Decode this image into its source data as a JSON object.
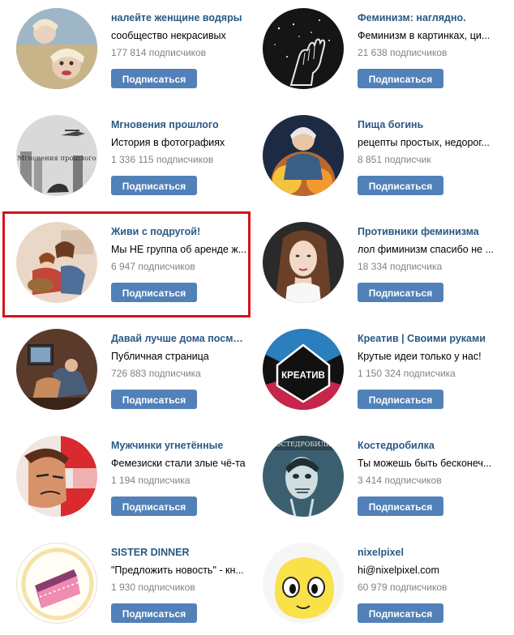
{
  "button_label": "Подписаться",
  "highlight_color": "#d3151b",
  "accent_color": "#5181b8",
  "link_color": "#2a5885",
  "groups": [
    {
      "name": "налейте женщине водяры",
      "description": "сообщество некрасивых",
      "subscribers": "177 814 подписчиков"
    },
    {
      "name": "Феминизм: наглядно.",
      "description": "Феминизм в картинках, ци...",
      "subscribers": "21 638 подписчиков"
    },
    {
      "name": "Мгновения прошлого",
      "description": "История в фотографиях",
      "subscribers": "1 336 115 подписчиков",
      "avatar_text": "Мгновения прошлого"
    },
    {
      "name": "Пища богинь",
      "description": "рецепты простых, недорог...",
      "subscribers": "8 851 подписчик"
    },
    {
      "name": "Живи с подругой!",
      "description": "Мы НЕ группа об аренде ж...",
      "subscribers": "6 947 подписчиков"
    },
    {
      "name": "Противники феминизма",
      "description": "лол фиминизм спасибо не ...",
      "subscribers": "18 334 подписчика"
    },
    {
      "name": "Давай лучше дома посмот...",
      "description": "Публичная страница",
      "subscribers": "726 883 подписчика"
    },
    {
      "name": "Креатив | Своими руками",
      "description": "Крутые идеи только у нас!",
      "subscribers": "1 150 324 подписчика",
      "avatar_text": "КРЕАТИВ"
    },
    {
      "name": "Мужчинки угнетённые",
      "description": "Фемезиски стали злые чё-та",
      "subscribers": "1 194 подписчика"
    },
    {
      "name": "Костедробилка",
      "description": "Ты можешь быть бесконеч...",
      "subscribers": "3 414 подписчиков",
      "avatar_text": "КОСТЕДРОБИЛКА"
    },
    {
      "name": "SISTER DINNER",
      "description": "\"Предложить новость\" - кн...",
      "subscribers": "1 930 подписчиков"
    },
    {
      "name": "nixelpixel",
      "description": "hi@nixelpixel.com",
      "subscribers": "60 979 подписчиков"
    }
  ]
}
